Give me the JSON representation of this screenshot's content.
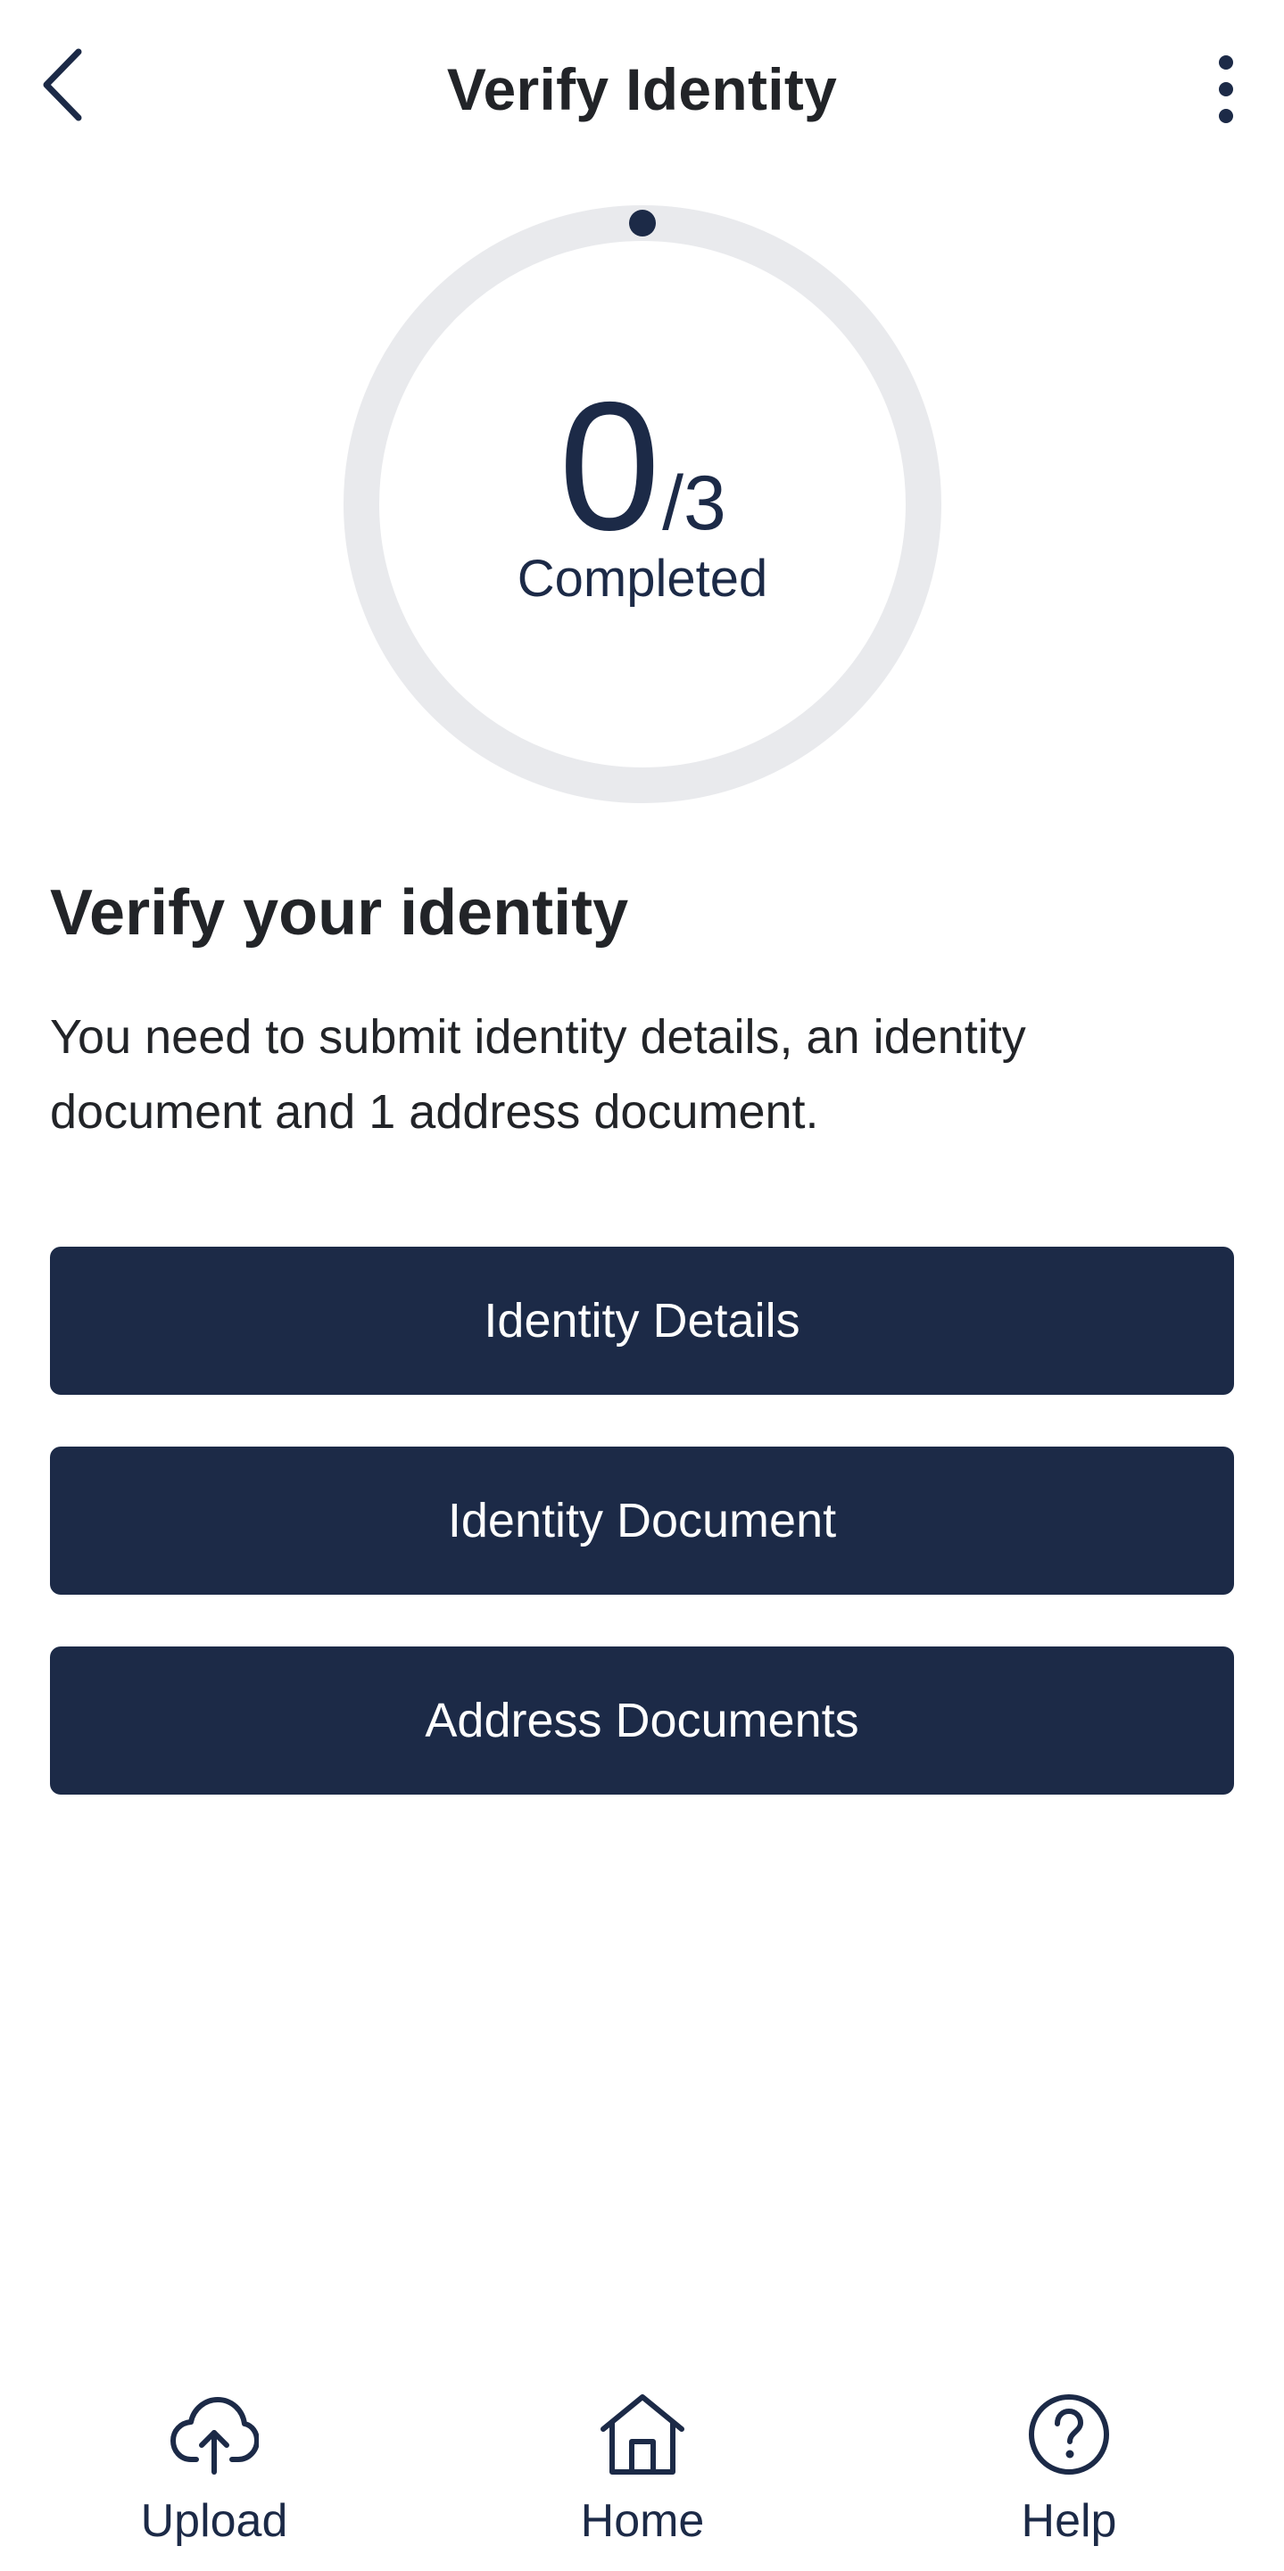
{
  "header": {
    "title": "Verify Identity",
    "back_icon": "chevron-left-icon",
    "more_icon": "more-vertical-icon"
  },
  "progress": {
    "completed": "0",
    "total": "/3",
    "label": "Completed",
    "fraction": 0
  },
  "content": {
    "title": "Verify your identity",
    "description": "You need to submit identity details, an identity document and 1 address document."
  },
  "actions": [
    {
      "label": "Identity Details"
    },
    {
      "label": "Identity Document"
    },
    {
      "label": "Address Documents"
    }
  ],
  "bottom_nav": [
    {
      "label": "Upload",
      "icon": "cloud-upload-icon"
    },
    {
      "label": "Home",
      "icon": "home-icon"
    },
    {
      "label": "Help",
      "icon": "help-circle-icon"
    }
  ],
  "colors": {
    "primary": "#1c2a47",
    "ring_track": "#e9eaed",
    "text": "#222428",
    "background": "#ffffff"
  }
}
